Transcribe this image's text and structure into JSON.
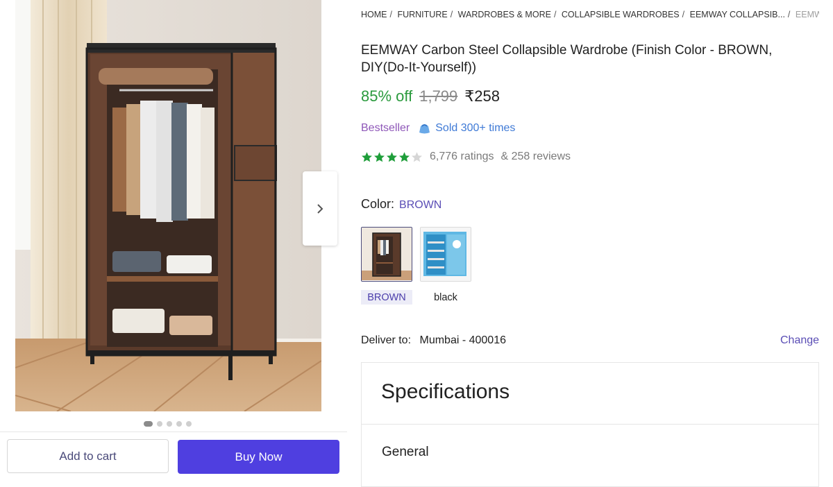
{
  "gallery": {
    "next_icon": "chevron-right-icon",
    "image_count": 5,
    "active_image": 1
  },
  "actions": {
    "add_to_cart": "Add to cart",
    "buy_now": "Buy Now"
  },
  "breadcrumb": [
    "HOME",
    "FURNITURE",
    "WARDROBES & MORE",
    "COLLAPSIBLE WARDROBES",
    "EEMWAY COLLAPSIB...",
    "EEMW..."
  ],
  "product": {
    "title": "EEMWAY Carbon Steel Collapsible Wardrobe (Finish Color - BROWN, DIY(Do-It-Yourself))",
    "discount": "85% off",
    "mrp": "1,799",
    "price": "₹258",
    "bestseller": "Bestseller",
    "sold": "Sold 300+ times",
    "rating_stars": 4,
    "ratings": "6,776 ratings",
    "reviews": "& 258 reviews"
  },
  "color": {
    "label": "Color:",
    "selected": "BROWN",
    "options": [
      "BROWN",
      "black"
    ]
  },
  "delivery": {
    "label": "Deliver to:",
    "location": "Mumbai - 400016",
    "change": "Change"
  },
  "specifications": {
    "title": "Specifications",
    "section": "General"
  },
  "colors": {
    "accent": "#4f3fe0",
    "discount_green": "#2a9a3d",
    "star_green": "#1f9e3a",
    "link": "#5a4db5"
  }
}
